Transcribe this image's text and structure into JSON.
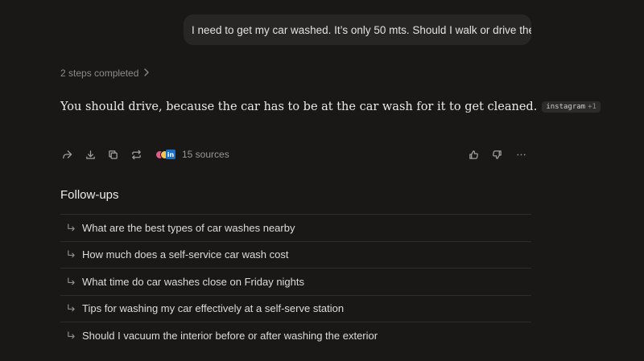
{
  "user_message": "I need to get my car washed. It’s only 50 mts. Should I walk or drive the",
  "steps": {
    "label": "2 steps completed",
    "icon": "chevron-right-icon"
  },
  "answer": {
    "text": "You should drive, because the car has to be at the car wash for it to get cleaned.",
    "citation": {
      "source": "instagram",
      "more": "+1"
    }
  },
  "toolbar": {
    "actions": [
      "share-icon",
      "download-icon",
      "copy-icon",
      "rewrite-icon"
    ],
    "sources_label": "15 sources",
    "feedback": [
      "thumbs-up-icon",
      "thumbs-down-icon",
      "more-icon"
    ],
    "linkedin_glyph": "in"
  },
  "followups": {
    "title": "Follow-ups",
    "items": [
      "What are the best types of car washes nearby",
      "How much does a self-service car wash cost",
      "What time do car washes close on Friday nights",
      "Tips for washing my car effectively at a self-serve station",
      "Should I vacuum the interior before or after washing the exterior"
    ]
  },
  "colors": {
    "background": "#191817",
    "bubble": "#272625",
    "text": "#e8e6e3",
    "muted": "#8f8c88"
  }
}
